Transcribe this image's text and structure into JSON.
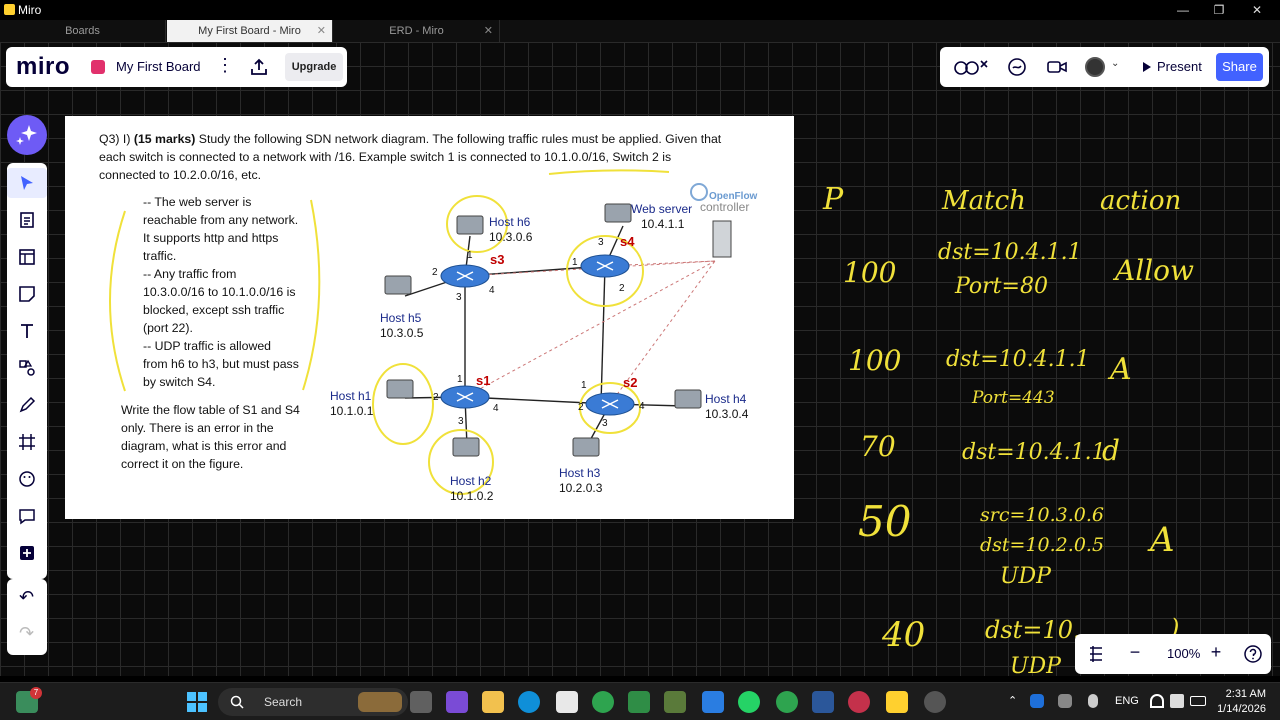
{
  "window": {
    "title": "Miro",
    "controls": [
      "—",
      "❐",
      "✕"
    ]
  },
  "tabs": [
    {
      "label": "Boards"
    },
    {
      "label": "My First Board - Miro",
      "close": "✕"
    },
    {
      "label": "ERD - Miro",
      "close": "✕"
    }
  ],
  "board": {
    "logo": "miro",
    "name": "My First Board",
    "upgrade_label": "Upgrade",
    "menu_glyph": "⋮"
  },
  "collab": {
    "present_label": "Present",
    "share_label": "Share",
    "caret": "⌄",
    "accent": "#4262ff"
  },
  "zoom": {
    "value": "100%",
    "minus": "−",
    "plus": "+"
  },
  "toolbar": {
    "tools": [
      "select-tool",
      "templates-tool",
      "frame-tool",
      "sticky-note-tool",
      "text-tool",
      "shapes-tool",
      "pen-tool",
      "crop-frame-tool",
      "reaction-tool",
      "comment-tool",
      "add-tool"
    ],
    "undo": "↶",
    "redo": "↷"
  },
  "document": {
    "question": {
      "prefix": "Q3) I) ",
      "marks": "(15 marks)",
      "line1": " Study the following SDN network diagram. The following traffic rules must be applied. Given that",
      "line2": "each switch is connected to a network with /16. Example switch 1 is connected to 10.1.0.0/16, Switch 2 is",
      "line3": "connected to 10.2.0.0/16, etc."
    },
    "rules": [
      "-- The web server is",
      "reachable from any network.",
      "It supports http and https",
      "traffic.",
      "-- Any traffic from",
      "10.3.0.0/16 to 10.1.0.0/16 is",
      "blocked, except ssh traffic",
      "(port 22).",
      "-- UDP traffic is allowed",
      "from h6 to h3, but must pass",
      "by switch S4."
    ],
    "task": [
      "Write the flow table of S1 and S4",
      "only. There is an error in the",
      "diagram, what is this error and",
      "correct it on the figure."
    ],
    "diagram": {
      "controller": {
        "line1": "OpenFlow",
        "line2": "controller"
      },
      "switches": [
        "s1",
        "s2",
        "s3",
        "s4"
      ],
      "hosts": {
        "h1": {
          "name": "Host h1",
          "ip": "10.1.0.1"
        },
        "h2": {
          "name": "Host h2",
          "ip": "10.1.0.2"
        },
        "h3": {
          "name": "Host h3",
          "ip": "10.2.0.3"
        },
        "h4": {
          "name": "Host h4",
          "ip": "10.3.0.4"
        },
        "h5": {
          "name": "Host h5",
          "ip": "10.3.0.5"
        },
        "h6": {
          "name": "Host h6",
          "ip": "10.3.0.6"
        },
        "web": {
          "name": "Web server",
          "ip": "10.4.1.1"
        }
      },
      "ports": {
        "s1": [
          "1",
          "2",
          "3",
          "4"
        ],
        "s2": [
          "1",
          "2",
          "3",
          "4"
        ],
        "s3": [
          "1",
          "2",
          "3",
          "4"
        ],
        "s4": [
          "1",
          "2",
          "3"
        ]
      }
    }
  },
  "handwriting": {
    "headers": [
      "P",
      "Match",
      "action"
    ],
    "rows": [
      {
        "p": "100",
        "match": [
          "dst=10.4.1.1",
          "Port=80"
        ],
        "action": "Allow"
      },
      {
        "p": "100",
        "match": [
          "dst=10.4.1.1",
          "Port=443"
        ],
        "action": "A"
      },
      {
        "p": "70",
        "match": [
          "dst=10.4.1.1"
        ],
        "action": "d"
      },
      {
        "p": "50",
        "match": [
          "src=10.3.0.6",
          "dst=10.2.0.5",
          "UDP"
        ],
        "action": "A"
      },
      {
        "p": "40",
        "match": [
          "dst=10.",
          "UDP"
        ],
        "action": ")"
      }
    ],
    "ink_color": "#f0e13a"
  },
  "taskbar": {
    "search_label": "Search",
    "language": "ENG",
    "time": "2:31 AM",
    "date": "1/14/2026",
    "notification_count": "7"
  }
}
